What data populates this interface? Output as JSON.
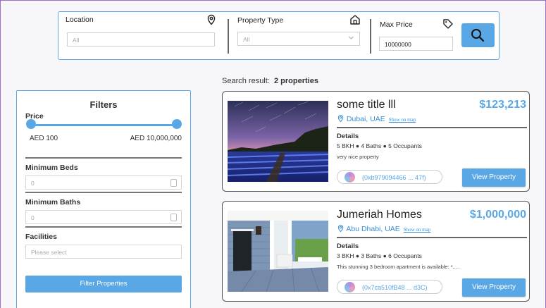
{
  "search": {
    "location_label": "Location",
    "location_placeholder": "All",
    "type_label": "Property Type",
    "type_value": "All",
    "price_label": "Max Price",
    "price_value": "10000000"
  },
  "results": {
    "prefix": "Search result:",
    "count": "2 properties"
  },
  "filters": {
    "title": "Filters",
    "price_label": "Price",
    "price_min": "AED 100",
    "price_max": "AED 10,000,000",
    "beds_label": "Minimum Beds",
    "beds_value": "0",
    "baths_label": "Minimum Baths",
    "baths_value": "0",
    "facilities_label": "Facilities",
    "facilities_placeholder": "Please select",
    "button": "Filter Properties"
  },
  "cards": [
    {
      "title": "some title lll",
      "price": "$123,213",
      "location": "Dubai, UAE",
      "map_link": "Show on map",
      "details_heading": "Details",
      "details": "5 BKH ● 4 Baths ● 5 Occupants",
      "description": "very nice property",
      "address": "(0xb979094466 ... 47f)",
      "button": "View Property"
    },
    {
      "title": "Jumeriah Homes",
      "price": "$1,000,000",
      "location": "Abu Dhabi, UAE",
      "map_link": "Show on map",
      "details_heading": "Details",
      "details": "3 BKH ● 3 Baths ● 6 Occupants",
      "description": "This stunning 3 bedroom apartment is available: *.....",
      "address": "(0x7ca510fB48 ... d3C)",
      "button": "View Property"
    }
  ],
  "colors": {
    "accent": "#5aa7e6",
    "link": "#3a8ed6"
  }
}
